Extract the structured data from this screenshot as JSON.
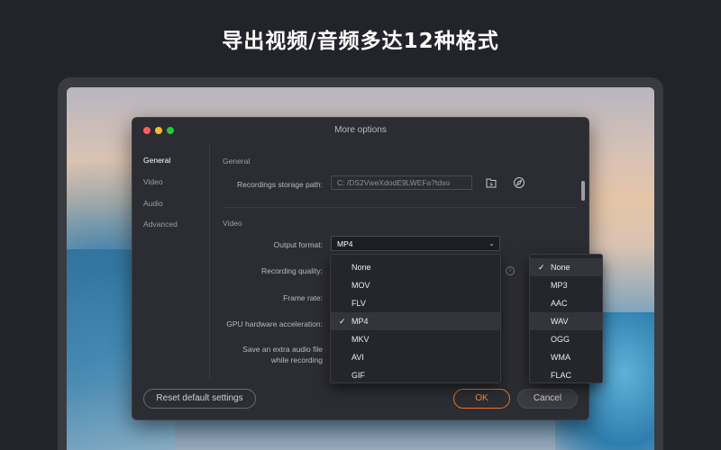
{
  "headline": "导出视频/音频多达12种格式",
  "dialog": {
    "title": "More options",
    "sidebar": [
      {
        "label": "General",
        "active": true
      },
      {
        "label": "Video",
        "active": false
      },
      {
        "label": "Audio",
        "active": false
      },
      {
        "label": "Advanced",
        "active": false
      }
    ],
    "general": {
      "section_label": "General",
      "storage_path_label": "Recordings storage path:",
      "storage_path_value": "C: /DS2VweXdodE9LWEFa?tdso",
      "open_folder_icon": "folder-open-icon",
      "browse_icon": "compass-icon"
    },
    "video": {
      "section_label": "Video",
      "output_format_label": "Output format:",
      "output_format_value": "MP4",
      "recording_quality_label": "Recording quality:",
      "frame_rate_label": "Frame rate:",
      "gpu_label": "GPU hardware acceleration:",
      "extra_audio_label_1": "Save an extra audio file",
      "extra_audio_label_2": "while recording"
    },
    "buttons": {
      "reset": "Reset default settings",
      "ok": "OK",
      "cancel": "Cancel"
    }
  },
  "format_dropdown": {
    "options": [
      "None",
      "MOV",
      "FLV",
      "MP4",
      "MKV",
      "AVI",
      "GIF"
    ],
    "selected": "MP4"
  },
  "audio_dropdown": {
    "options": [
      "None",
      "MP3",
      "AAC",
      "WAV",
      "OGG",
      "WMA",
      "FLAC"
    ],
    "selected": "None",
    "highlighted": "WAV"
  },
  "colors": {
    "accent": "#e8742a",
    "background": "#23242b",
    "dialog": "#2c2d33"
  }
}
